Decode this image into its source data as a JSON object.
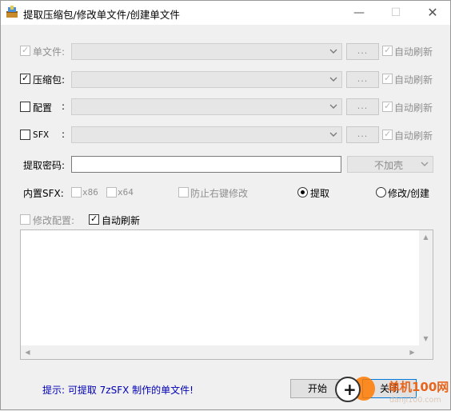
{
  "window": {
    "title": "提取压缩包/修改单文件/创建单文件",
    "controls": {
      "minimize": "—",
      "maximize": "☐",
      "close": "✕"
    }
  },
  "rows": [
    {
      "label": "单文件:",
      "checked": true,
      "enabled": false,
      "dots": "...",
      "refresh_label": "自动刷新"
    },
    {
      "label": "压缩包:",
      "checked": true,
      "enabled": true,
      "dots": "...",
      "refresh_label": "自动刷新"
    },
    {
      "label": "配置",
      "colon": ":",
      "checked": false,
      "enabled": true,
      "dots": "...",
      "refresh_label": "自动刷新"
    },
    {
      "label": "SFX",
      "colon": ":",
      "checked": false,
      "enabled": true,
      "dots": "...",
      "refresh_label": "自动刷新"
    }
  ],
  "password": {
    "label": "提取密码:",
    "value": "",
    "shell_option": "不加壳"
  },
  "sfx": {
    "label": "内置SFX:",
    "x86_label": "x86",
    "x64_label": "x64",
    "prevent_label": "防止右键修改"
  },
  "mode": {
    "extract_label": "提取",
    "modify_label": "修改/创建",
    "selected": "extract"
  },
  "config": {
    "modify_label": "修改配置:",
    "auto_refresh_label": "自动刷新"
  },
  "scroll": {
    "up": "▲",
    "down": "▼",
    "left": "◀",
    "right": "▶"
  },
  "footer": {
    "hint": "提示: 可提取 7zSFX 制作的单文件!",
    "start_label": "开始",
    "close_label": "关闭"
  },
  "watermark": {
    "plus": "+",
    "brand": "单机100网",
    "url": "danji100.com",
    "brand_color": "#e8651c"
  },
  "colors": {
    "hint": "#0000b4",
    "accent_border": "#0078d7"
  }
}
